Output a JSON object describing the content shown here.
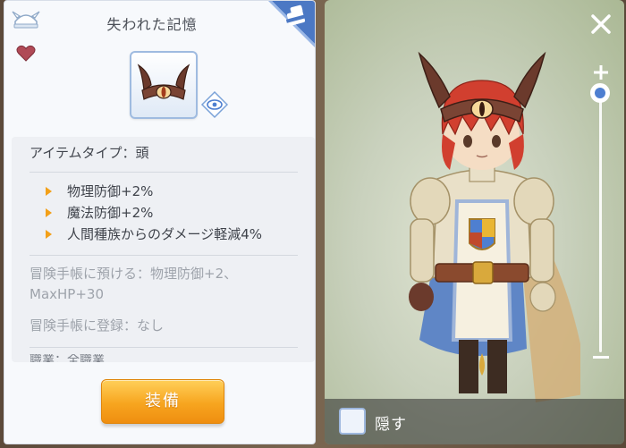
{
  "item_panel": {
    "title": "失われた記憶",
    "item_type": "アイテムタイプ：頭",
    "effects": [
      "物理防御+2%",
      "魔法防御+2%",
      "人間種族からのダメージ軽減4%"
    ],
    "deposit_text": "冒険手帳に預ける：物理防御+2、MaxHP+30",
    "register_text": "冒険手帳に登録：なし",
    "truncated_text": "職業：全職業",
    "equip_label": "装備"
  },
  "preview_panel": {
    "hide_label": "隠す"
  },
  "colors": {
    "accent_orange": "#f7a51f",
    "accent_blue": "#4e7fd0",
    "panel_bg": "#f7f9fc"
  },
  "icons": [
    "helmet-icon",
    "heart-icon",
    "ribbon-corner-icon",
    "eye-icon",
    "close-icon",
    "zoom-in-icon",
    "zoom-out-icon"
  ]
}
